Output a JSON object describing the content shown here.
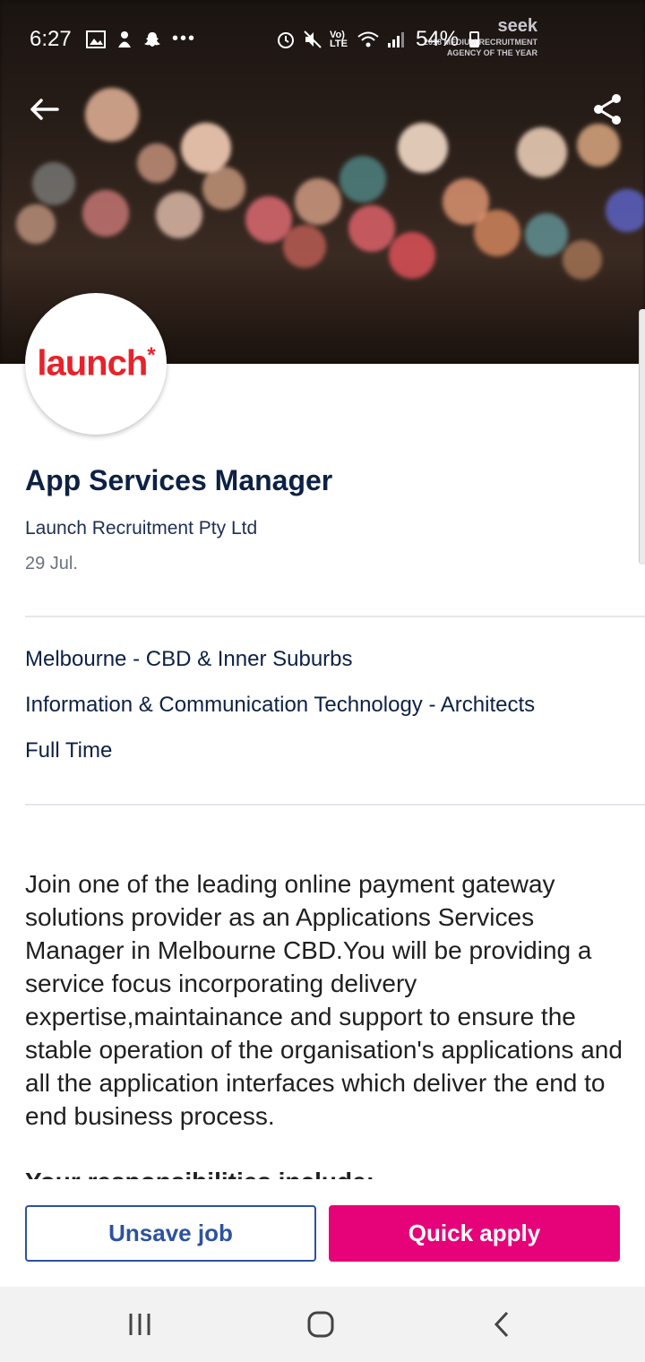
{
  "status_bar": {
    "time": "6:27",
    "battery": "54%",
    "network": "Vo) LTE"
  },
  "brand": {
    "logo": "seek",
    "tagline_line1": "2018 MEDIUM RECRUITMENT",
    "tagline_line2": "AGENCY OF THE YEAR"
  },
  "toolbar": {
    "back_icon": "arrow-left-icon",
    "share_icon": "share-icon"
  },
  "company_logo": {
    "text": "launch",
    "mark": "*",
    "color": "#e8222a"
  },
  "job": {
    "title": "App Services Manager",
    "company": "Launch Recruitment Pty Ltd",
    "posted": "29 Jul."
  },
  "meta": {
    "location": "Melbourne - CBD & Inner Suburbs",
    "classification": "Information & Communication Technology - Architects",
    "work_type": "Full Time"
  },
  "description": {
    "body": "Join one of the leading online payment gateway solutions provider as an Applications Services Manager in Melbourne CBD.You will be providing a service focus incorporating delivery expertise,maintainance and support to ensure the stable operation of the organisation's applications and all the application interfaces which deliver the end to end business process.",
    "next_heading": "Your responsibilities include:"
  },
  "actions": {
    "unsave_label": "Unsave job",
    "apply_label": "Quick apply",
    "apply_color": "#e60278",
    "unsave_color": "#2c52a0"
  },
  "navbar": {
    "recent_icon": "recent-apps-icon",
    "home_icon": "home-icon",
    "back_icon": "nav-back-icon"
  }
}
